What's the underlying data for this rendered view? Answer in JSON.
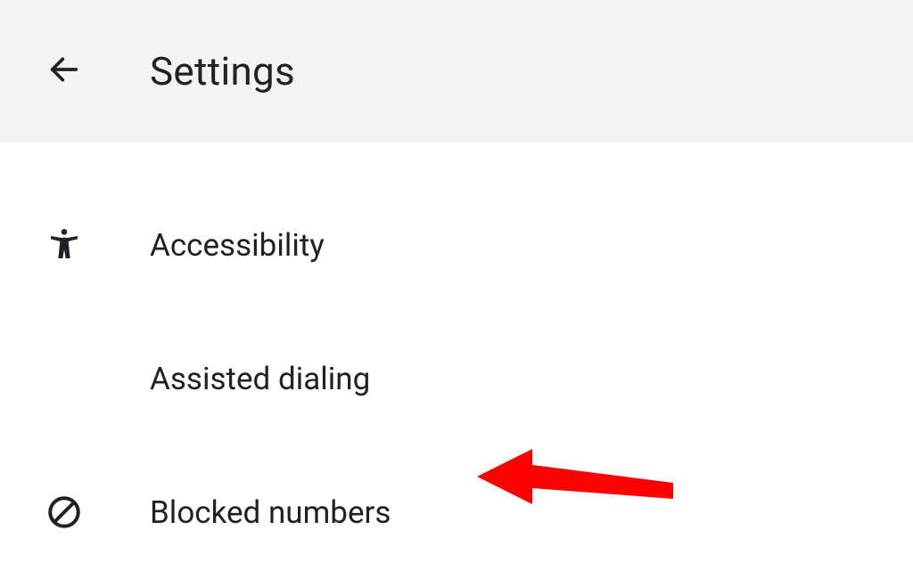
{
  "header": {
    "title": "Settings"
  },
  "items": [
    {
      "label": "Accessibility",
      "icon": "accessibility"
    },
    {
      "label": "Assisted dialing",
      "icon": ""
    },
    {
      "label": "Blocked numbers",
      "icon": "blocked"
    }
  ],
  "annotation": {
    "color": "#ff0000"
  }
}
